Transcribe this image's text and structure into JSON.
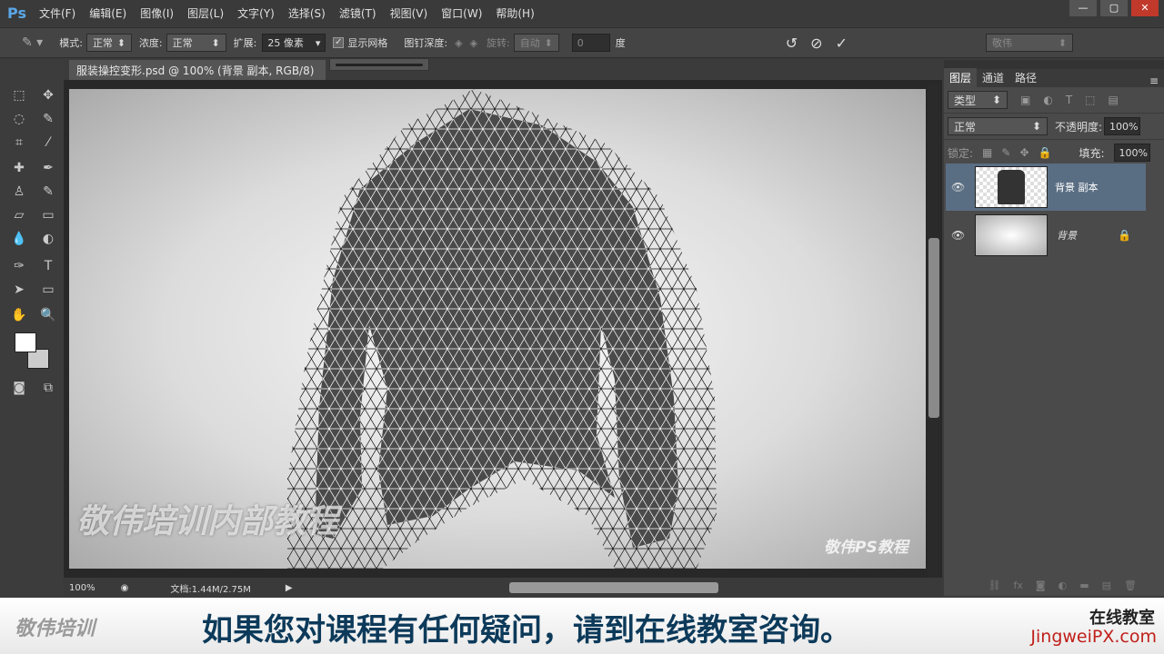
{
  "app": {
    "logo": "Ps",
    "menu": [
      "文件(F)",
      "编辑(E)",
      "图像(I)",
      "图层(L)",
      "文字(Y)",
      "选择(S)",
      "滤镜(T)",
      "视图(V)",
      "窗口(W)",
      "帮助(H)"
    ],
    "window_controls": [
      "—",
      "▢",
      "✕"
    ]
  },
  "options": {
    "mode_label": "模式:",
    "mode_value": "正常",
    "density_label": "浓度:",
    "density_value": "正常",
    "expand_label": "扩展:",
    "expand_value": "25 像素",
    "show_mesh_label": "显示网格",
    "show_mesh_checked": true,
    "pin_depth_label": "图钉深度:",
    "rotate_label": "旋转:",
    "rotate_value": "自动",
    "angle_value": "0",
    "angle_unit": "度",
    "workspace": "敬伟"
  },
  "document": {
    "tab_title": "服装操控变形.psd @ 100% (背景 副本, RGB/8)",
    "watermark_left": "敬伟培训内部教程",
    "watermark_right": "敬伟PS教程"
  },
  "status": {
    "zoom": "100%",
    "doc_info": "文档:1.44M/2.75M"
  },
  "layers_panel": {
    "tabs": [
      "图层",
      "通道",
      "路径"
    ],
    "filter": "类型",
    "blend_mode": "正常",
    "opacity_label": "不透明度:",
    "opacity": "100%",
    "lock_label": "锁定:",
    "fill_label": "填充:",
    "fill": "100%",
    "layers": [
      {
        "name": "背景 副本",
        "selected": true
      },
      {
        "name": "背景",
        "locked": true
      }
    ]
  },
  "banner": {
    "brand": "敬伟培训",
    "subtitle": "如果您对课程有任何疑问，请到在线教室咨询。",
    "site_line1": "在线教室",
    "site_line2": "JingweiPX.com"
  }
}
